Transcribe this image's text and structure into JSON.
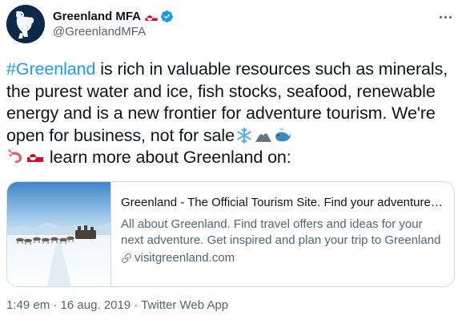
{
  "account": {
    "display_name": "Greenland MFA",
    "handle": "@GreenlandMFA",
    "flag_icon": "greenland-flag-icon",
    "verified_icon": "verified-badge-icon",
    "avatar_icon": "polar-bear-avatar"
  },
  "menu": {
    "icon": "more-options-icon"
  },
  "tweet": {
    "hashtag": "#Greenland",
    "text_main": " is rich in valuable resources such as minerals, the purest water and ice, fish stocks, seafood, renewable energy and is a new frontier for adventure tourism. We're open for business, not for sale",
    "text_tail": " learn more about Greenland on:",
    "emojis": [
      "snowflake",
      "mountain",
      "whale",
      "shrimp",
      "greenland-flag"
    ]
  },
  "card": {
    "title": "Greenland - The Official Tourism Site. Find your adventure here",
    "description": "All about Greenland. Find travel offers and ideas for your next adventure. Get inspired and plan your trip to Greenland here.",
    "domain": "visitgreenland.com",
    "image": "dog-sledding-snow-photo",
    "link_icon": "link-icon"
  },
  "meta": {
    "time": "1:49 em",
    "separator": " · ",
    "date": "16 aug. 2019",
    "source": "Twitter Web App"
  },
  "colors": {
    "accent": "#1d9bf0",
    "text": "#0f1419",
    "secondary": "#536471",
    "border": "#cfd9de"
  }
}
